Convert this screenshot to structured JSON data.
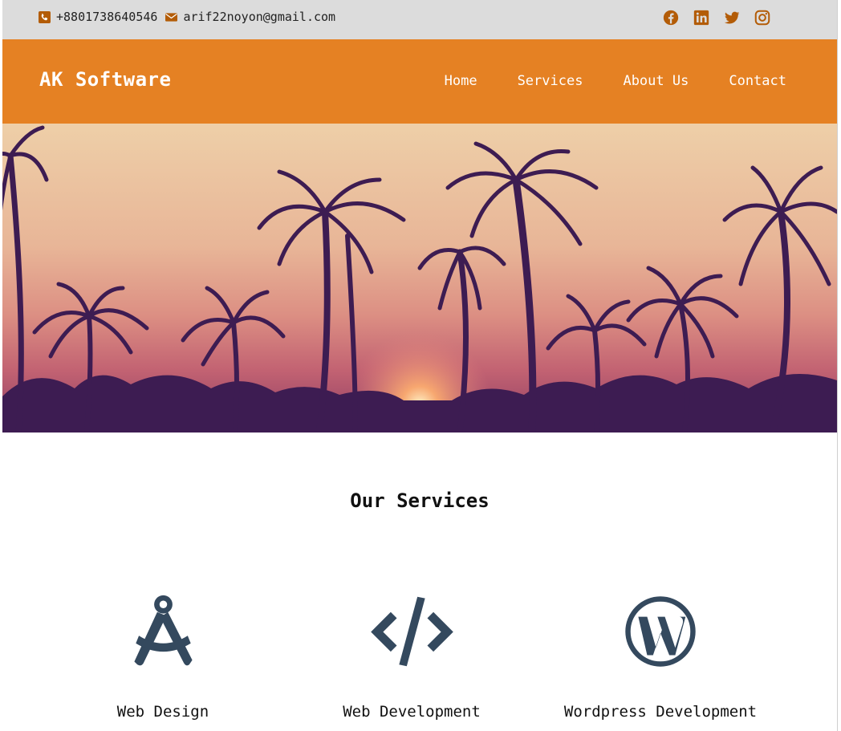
{
  "topbar": {
    "phone": "+8801738640546",
    "email": "arif22noyon@gmail.com",
    "social_icons": [
      "facebook-icon",
      "linkedin-icon",
      "twitter-icon",
      "instagram-icon"
    ],
    "icon_color": "#b35c07"
  },
  "navbar": {
    "brand": "AK Software",
    "menu": [
      "Home",
      "Services",
      "About Us",
      "Contact"
    ],
    "background": "#e58123"
  },
  "services": {
    "title": "Our Services",
    "items": [
      {
        "label": "Web Design",
        "icon": "drafting-compass-icon"
      },
      {
        "label": "Web Development",
        "icon": "code-icon"
      },
      {
        "label": "Wordpress Development",
        "icon": "wordpress-icon"
      }
    ],
    "icon_color": "#34495e"
  }
}
